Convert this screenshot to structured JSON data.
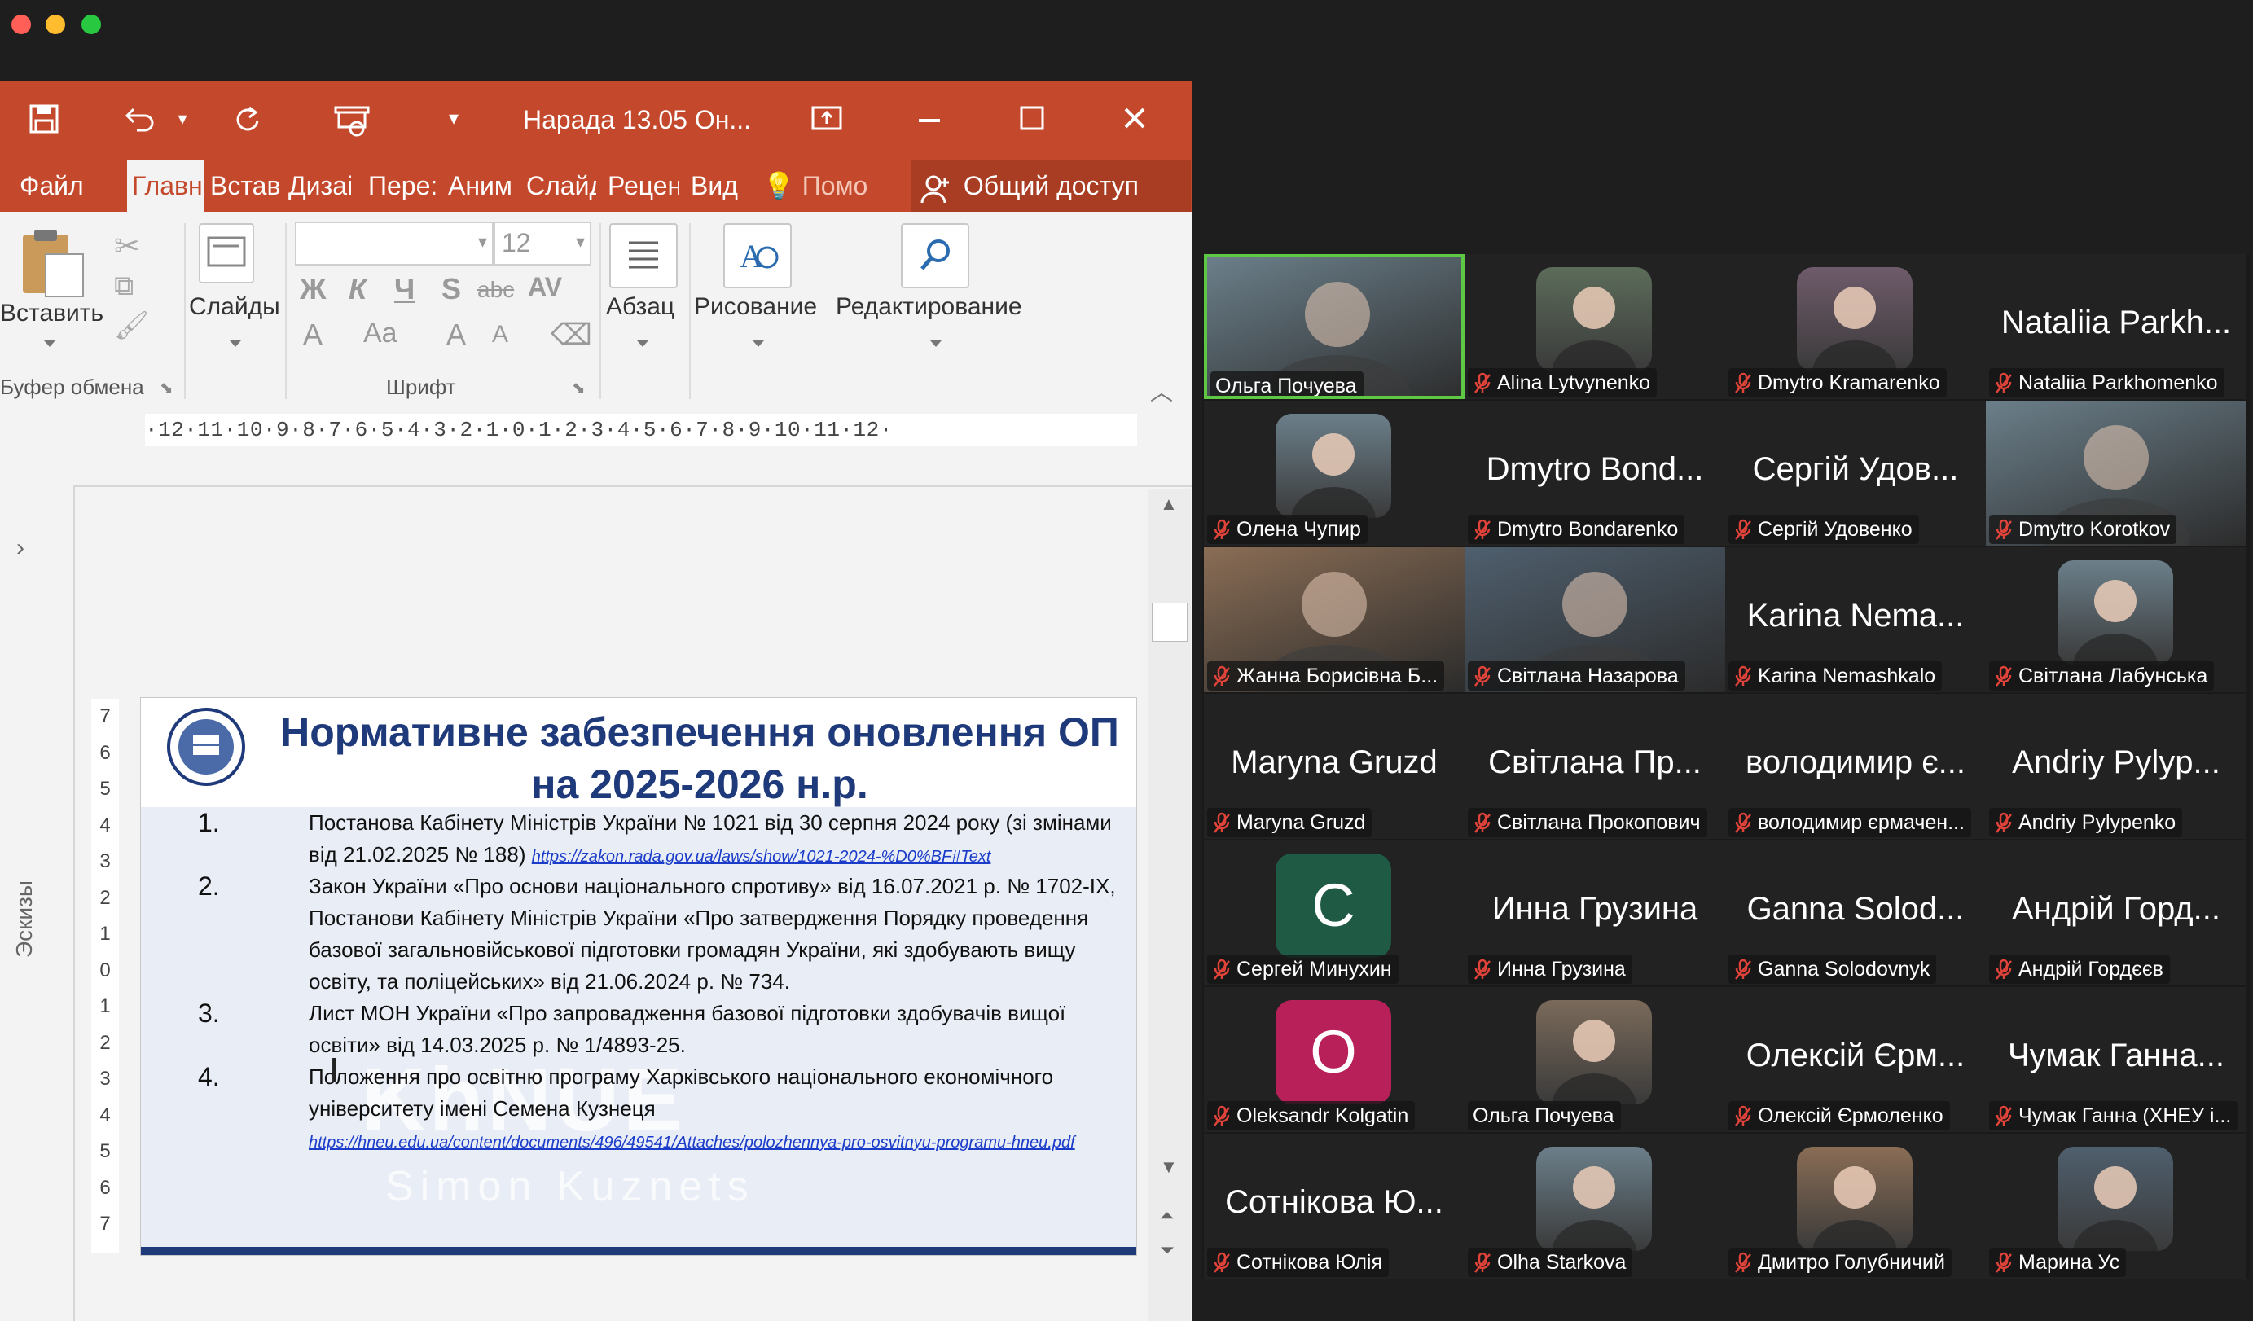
{
  "ppt": {
    "doc_title": "Нарада 13.05 Он...",
    "tabs": [
      "Файл",
      "Главн",
      "Встав",
      "Дизаі",
      "Пере:",
      "Аним",
      "Слайд",
      "Рецен",
      "Вид"
    ],
    "tell_me": "Помо",
    "share": "Общий доступ",
    "ribbon": {
      "paste": "Вставить",
      "clipboard_group": "Буфер обмена",
      "slides": "Слайды",
      "font_size": "12",
      "font_group": "Шрифт",
      "format_buttons": [
        "Ж",
        "К",
        "Ч",
        "S",
        "abc",
        "AV"
      ],
      "paragraph": "Абзац",
      "drawing": "Рисование",
      "editing": "Редактирование"
    },
    "thumbnails_label": "Эскизы",
    "ruler_h": "·12·11·10·9·8·7·6·5·4·3·2·1·0·1·2·3·4·5·6·7·8·9·10·11·12·",
    "ruler_v": "7 6 5 4 3 2 1 0 1 2 3 4 5 6 7"
  },
  "slide": {
    "title": "Нормативне забезпечення оновлення ОП на 2025-2026 н.р.",
    "items": [
      {
        "num": "1.",
        "text": "Постанова Кабінету Міністрів України № 1021 від 30 серпня 2024 року (зі змінами від 21.02.2025 № 188)",
        "link": "https://zakon.rada.gov.ua/laws/show/1021-2024-%D0%BF#Text"
      },
      {
        "num": "2.",
        "text": "Закон України «Про основи національного спротиву» від 16.07.2021 р. № 1702-IX, Постанови Кабінету Міністрів України «Про затвердження Порядку проведення базової загальновійськової підготовки громадян України, які здобувають вищу освіту, та поліцейських» від 21.06.2024 р. № 734.",
        "link": ""
      },
      {
        "num": "3.",
        "text": "Лист МОН України «Про запровадження базової підготовки здобувачів вищої освіти» від 14.03.2025 р. № 1/4893-25.",
        "link": ""
      },
      {
        "num": "4.",
        "text": "Положення про освітню програму Харківського національного економічного університету імені Семена Кузнеця",
        "link": "https://hneu.edu.ua/content/documents/496/49541/Attaches/polozhennya-pro-osvitnyu-programu-hneu.pdf"
      }
    ],
    "watermark": "KhNUE",
    "watermark_sub": "Simon Kuznets"
  },
  "participants": [
    {
      "name": "Ольга Почуева",
      "big": "",
      "type": "video",
      "speaking": true,
      "muted": false
    },
    {
      "name": "Alina Lytvynenko",
      "big": "",
      "type": "photo",
      "muted": true
    },
    {
      "name": "Dmytro Kramarenko",
      "big": "",
      "type": "photo",
      "muted": true
    },
    {
      "name": "Nataliia Parkhomenko",
      "big": "Nataliia Parkh...",
      "type": "text",
      "muted": true
    },
    {
      "name": "Олена Чупир",
      "big": "",
      "type": "photo",
      "muted": true
    },
    {
      "name": "Dmytro Bondarenko",
      "big": "Dmytro Bond...",
      "type": "text",
      "muted": true
    },
    {
      "name": "Сергій Удовенко",
      "big": "Сергій Удов...",
      "type": "text",
      "muted": true
    },
    {
      "name": "Dmytro Korotkov",
      "big": "",
      "type": "video",
      "muted": true
    },
    {
      "name": "Жанна Борисівна Б...",
      "big": "",
      "type": "video",
      "muted": true
    },
    {
      "name": "Світлана Назарова",
      "big": "",
      "type": "video",
      "muted": true
    },
    {
      "name": "Karina Nemashkalo",
      "big": "Karina Nema...",
      "type": "text",
      "muted": true
    },
    {
      "name": "Світлана Лабунська",
      "big": "",
      "type": "photo",
      "muted": true
    },
    {
      "name": "Maryna Gruzd",
      "big": "Maryna Gruzd",
      "type": "text",
      "muted": true
    },
    {
      "name": "Світлана Прокопович",
      "big": "Світлана Пр...",
      "type": "text",
      "muted": true
    },
    {
      "name": "володимир єрмачен...",
      "big": "володимир є...",
      "type": "text",
      "muted": true
    },
    {
      "name": "Andriy Pylypenko",
      "big": "Andriy Pylyp...",
      "type": "text",
      "muted": true
    },
    {
      "name": "Сергей Минухин",
      "big": "",
      "type": "letter",
      "letter": "С",
      "muted": true
    },
    {
      "name": "Инна Грузина",
      "big": "Инна Грузина",
      "type": "text",
      "muted": true
    },
    {
      "name": "Ganna Solodovnyk",
      "big": "Ganna Solod...",
      "type": "text",
      "muted": true
    },
    {
      "name": "Андрій Гордєєв",
      "big": "Андрій Горд...",
      "type": "text",
      "muted": true
    },
    {
      "name": "Oleksandr Kolgatin",
      "big": "",
      "type": "letter",
      "letter": "O",
      "muted": true
    },
    {
      "name": "Ольга Почуева",
      "big": "",
      "type": "photo",
      "muted": false
    },
    {
      "name": "Олексій Єрмоленко",
      "big": "Олексій Єрм...",
      "type": "text",
      "muted": true
    },
    {
      "name": "Чумак Ганна (ХНЕУ і...",
      "big": "Чумак Ганна...",
      "type": "text",
      "muted": true
    },
    {
      "name": "Сотнікова Юлія",
      "big": "Сотнікова Ю...",
      "type": "text",
      "muted": true
    },
    {
      "name": "Olha Starkova",
      "big": "",
      "type": "photo",
      "muted": true
    },
    {
      "name": "Дмитро Голубничий",
      "big": "",
      "type": "photo",
      "muted": true
    },
    {
      "name": "Марина Ус",
      "big": "",
      "type": "photo",
      "muted": true
    }
  ],
  "colors": {
    "ppt_accent": "#c4482b",
    "slide_title": "#1f3a7a",
    "speaking_border": "#5ec845",
    "mic_muted": "#e0433a"
  }
}
